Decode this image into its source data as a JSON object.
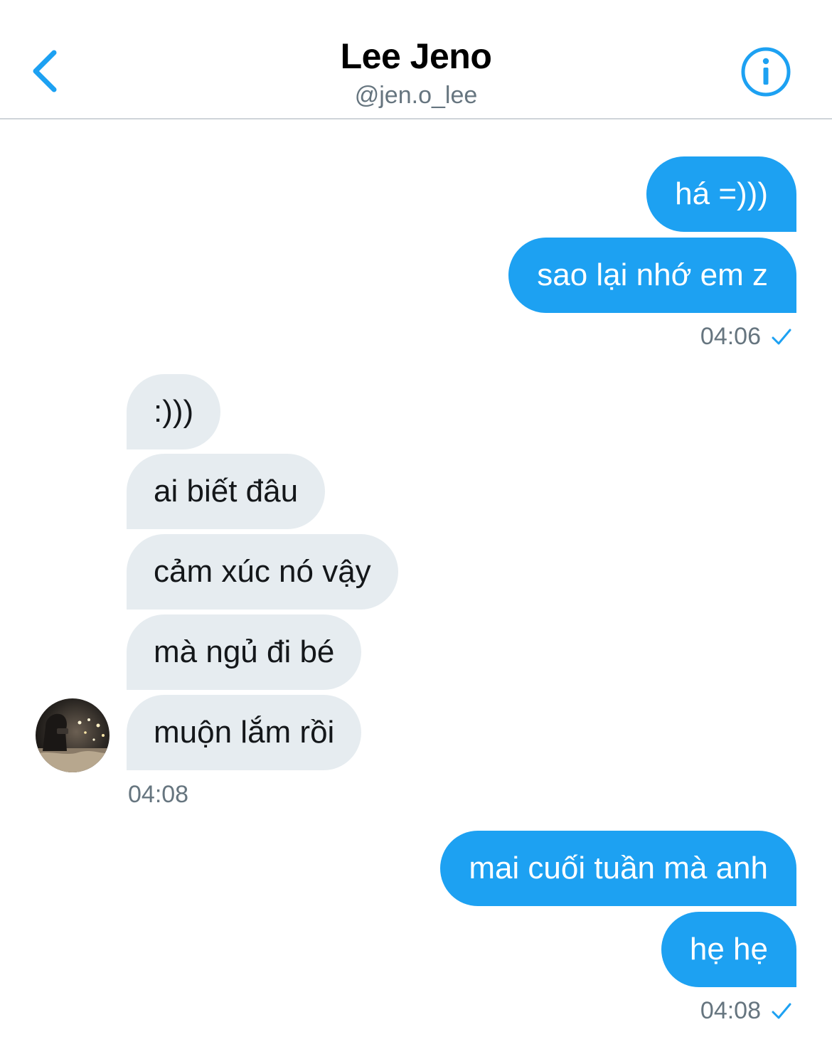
{
  "header": {
    "name": "Lee Jeno",
    "handle": "@jen.o_lee",
    "back_icon": "chevron-left-icon",
    "info_icon": "info-circle-icon"
  },
  "messages": [
    {
      "direction": "outgoing",
      "text": "há =)))"
    },
    {
      "direction": "outgoing",
      "text": "sao lại nhớ em z"
    },
    {
      "direction": "outgoing",
      "time": "04:06",
      "status_icon": "check-icon"
    },
    {
      "direction": "incoming",
      "text": ":)))"
    },
    {
      "direction": "incoming",
      "text": "ai biết đâu"
    },
    {
      "direction": "incoming",
      "text": "cảm xúc nó vậy"
    },
    {
      "direction": "incoming",
      "text": "mà ngủ đi bé"
    },
    {
      "direction": "incoming",
      "text": "muộn lắm rồi"
    },
    {
      "direction": "incoming",
      "time": "04:08"
    },
    {
      "direction": "outgoing",
      "text": "mai cuối tuần mà anh"
    },
    {
      "direction": "outgoing",
      "text": "hẹ hẹ"
    },
    {
      "direction": "outgoing",
      "time": "04:08",
      "status_icon": "check-icon"
    }
  ],
  "colors": {
    "accent": "#1da1f2",
    "incoming_bubble": "#e6ecf0",
    "meta_text": "#66757f"
  }
}
